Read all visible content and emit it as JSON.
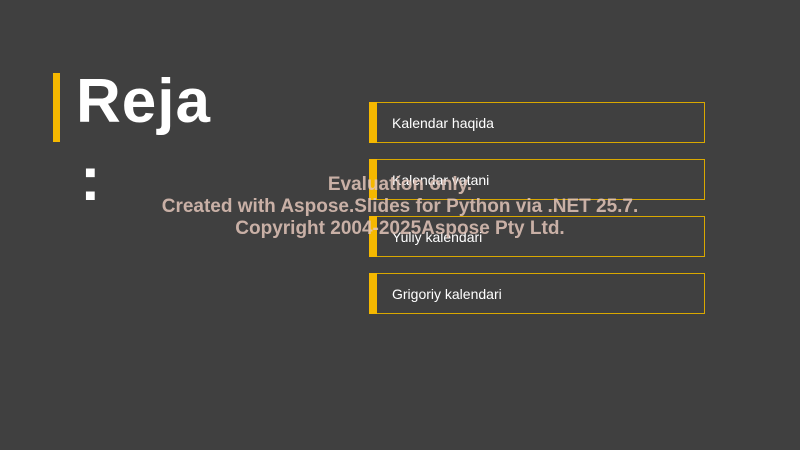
{
  "slide": {
    "title": "Reja",
    "title_colon": ":",
    "accent_color": "#f5b800",
    "background_color": "#404040"
  },
  "agenda": {
    "items": [
      {
        "label": "Kalendar haqida"
      },
      {
        "label": "Kalendar vatani"
      },
      {
        "label": "Yuliy kalendari"
      },
      {
        "label": "Grigoriy kalendari"
      }
    ]
  },
  "watermark": {
    "line1": "Evaluation only.",
    "line2": "Created with Aspose.Slides for Python via .NET 25.7.",
    "line3": "Copyright 2004-2025Aspose Pty Ltd."
  }
}
